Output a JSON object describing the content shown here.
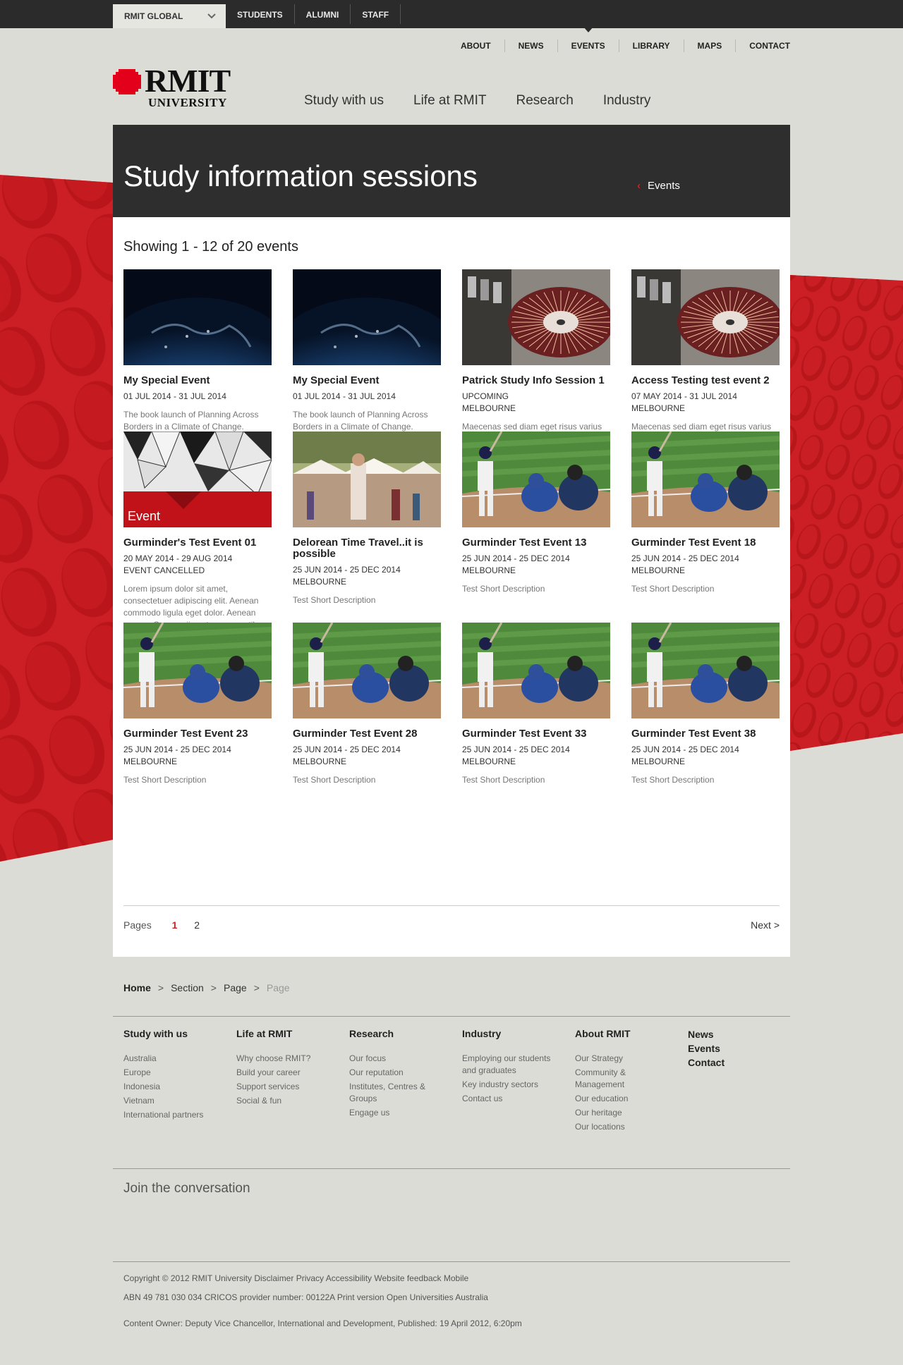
{
  "topbar": {
    "global_label": "RMIT GLOBAL",
    "links": [
      "STUDENTS",
      "ALUMNI",
      "STAFF"
    ]
  },
  "utility_nav": [
    "ABOUT",
    "NEWS",
    "EVENTS",
    "LIBRARY",
    "MAPS",
    "CONTACT"
  ],
  "utility_active": "EVENTS",
  "logo": {
    "line1": "RMIT",
    "line2": "UNIVERSITY"
  },
  "main_nav": [
    "Study with us",
    "Life at RMIT",
    "Research",
    "Industry"
  ],
  "hero": {
    "title": "Study information sessions",
    "back_link": "Events"
  },
  "listing": {
    "showing": "Showing 1 - 12 of 20 events",
    "events": [
      {
        "title": "My Special Event",
        "meta": [
          "01 JUL 2014 - 31 JUL 2014"
        ],
        "desc": "The book launch of Planning Across Borders in a Climate of Change.",
        "image": "earth"
      },
      {
        "title": "My Special Event",
        "meta": [
          "01 JUL 2014 - 31 JUL 2014"
        ],
        "desc": "The book launch of Planning Across Borders in a Climate of Change.",
        "image": "earth"
      },
      {
        "title": "Patrick Study Info Session 1",
        "meta": [
          "UPCOMING",
          "MELBOURNE"
        ],
        "desc": "Maecenas sed diam eget risus varius blandit sit amet non magna.",
        "image": "turntable"
      },
      {
        "title": "Access Testing test event 2",
        "meta": [
          "07 MAY 2014 - 31 JUL 2014",
          "MELBOURNE"
        ],
        "desc": "Maecenas sed diam eget risus varius blandit sit amet non magna.",
        "image": "turntable"
      },
      {
        "title": "Gurminder's Test Event 01",
        "meta": [
          "20 MAY 2014 - 29 AUG 2014",
          "EVENT CANCELLED"
        ],
        "desc": "Lorem ipsum dolor sit amet, consectetuer adipiscing elit. Aenean commodo ligula eget dolor. Aenean massa. Cum sociis natoque penatibus et ma",
        "image": "geometric",
        "image_caption": "Event"
      },
      {
        "title": "Delorean Time Travel..it is possible",
        "meta": [
          "25 JUN 2014 - 25 DEC 2014",
          "MELBOURNE"
        ],
        "desc": "Test Short Description",
        "image": "market"
      },
      {
        "title": "Gurminder Test Event 13",
        "meta": [
          "25 JUN 2014 - 25 DEC 2014",
          "MELBOURNE"
        ],
        "desc": "Test Short Description",
        "image": "baseball"
      },
      {
        "title": "Gurminder Test Event 18",
        "meta": [
          "25 JUN 2014 - 25 DEC 2014",
          "MELBOURNE"
        ],
        "desc": "Test Short Description",
        "image": "baseball"
      },
      {
        "title": "Gurminder Test Event 23",
        "meta": [
          "25 JUN 2014 - 25 DEC 2014",
          "MELBOURNE"
        ],
        "desc": "Test Short Description",
        "image": "baseball"
      },
      {
        "title": "Gurminder Test Event 28",
        "meta": [
          "25 JUN 2014 - 25 DEC 2014",
          "MELBOURNE"
        ],
        "desc": "Test Short Description",
        "image": "baseball"
      },
      {
        "title": "Gurminder Test Event 33",
        "meta": [
          "25 JUN 2014 - 25 DEC 2014",
          "MELBOURNE"
        ],
        "desc": "Test Short Description",
        "image": "baseball"
      },
      {
        "title": "Gurminder Test Event 38",
        "meta": [
          "25 JUN 2014 - 25 DEC 2014",
          "MELBOURNE"
        ],
        "desc": "Test Short Description",
        "image": "baseball"
      }
    ]
  },
  "pager": {
    "label": "Pages",
    "pages": [
      "1",
      "2"
    ],
    "current": "1",
    "next": "Next >"
  },
  "breadcrumb": {
    "items": [
      "Home",
      "Section",
      "Page"
    ],
    "current": "Page",
    "separator": ">"
  },
  "footer": {
    "columns": [
      {
        "heading": "Study with us",
        "links": [
          "Australia",
          "Europe",
          "Indonesia",
          "Vietnam",
          "International partners"
        ]
      },
      {
        "heading": "Life at RMIT",
        "links": [
          "Why choose RMIT?",
          "Build your career",
          "Support services",
          "Social & fun"
        ]
      },
      {
        "heading": "Research",
        "links": [
          "Our focus",
          "Our reputation",
          "Institutes, Centres & Groups",
          "Engage us"
        ]
      },
      {
        "heading": "Industry",
        "links": [
          "Employing our students and graduates",
          "Key industry sectors",
          "Contact us"
        ]
      },
      {
        "heading": "About RMIT",
        "links": [
          "Our Strategy",
          "Community & Management",
          "Our education",
          "Our heritage",
          "Our locations"
        ]
      }
    ],
    "plain_links": [
      "News",
      "Events",
      "Contact"
    ],
    "join": "Join the conversation",
    "legal": [
      "Copyright © 2012 RMIT University Disclaimer Privacy Accessibility Website feedback Mobile",
      "ABN 49 781 030 034 CRICOS provider number: 00122A Print version Open Universities Australia",
      "Content Owner: Deputy Vice Chancellor, International and Development, Published: 19 April 2012, 6:20pm"
    ]
  },
  "colors": {
    "brand_red": "#d51e23",
    "dark_bar": "#2b2b2b",
    "page_bg": "#dcdcd6"
  }
}
